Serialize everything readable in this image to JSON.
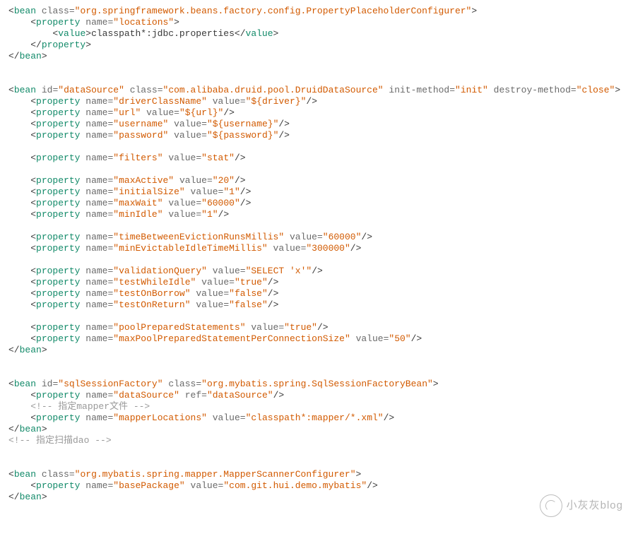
{
  "indent": "    ",
  "beans": [
    {
      "tag": "bean",
      "attrs": [
        [
          "class",
          "org.springframework.beans.factory.config.PropertyPlaceholderConfigurer"
        ]
      ],
      "children": [
        {
          "tag": "property",
          "attrs": [
            [
              "name",
              "locations"
            ]
          ],
          "children": [
            {
              "tag": "value",
              "text": "classpath*:jdbc.properties"
            }
          ]
        }
      ]
    },
    {
      "tag": "bean",
      "attrs": [
        [
          "id",
          "dataSource"
        ],
        [
          "class",
          "com.alibaba.druid.pool.DruidDataSource"
        ],
        [
          "init-method",
          "init"
        ],
        [
          "destroy-method",
          "close"
        ]
      ],
      "children": [
        {
          "tag": "property",
          "attrs": [
            [
              "name",
              "driverClassName"
            ],
            [
              "value",
              "${driver}"
            ]
          ],
          "selfclose": true
        },
        {
          "tag": "property",
          "attrs": [
            [
              "name",
              "url"
            ],
            [
              "value",
              "${url}"
            ]
          ],
          "selfclose": true
        },
        {
          "tag": "property",
          "attrs": [
            [
              "name",
              "username"
            ],
            [
              "value",
              "${username}"
            ]
          ],
          "selfclose": true
        },
        {
          "tag": "property",
          "attrs": [
            [
              "name",
              "password"
            ],
            [
              "value",
              "${password}"
            ]
          ],
          "selfclose": true
        },
        {
          "blank": true
        },
        {
          "tag": "property",
          "attrs": [
            [
              "name",
              "filters"
            ],
            [
              "value",
              "stat"
            ]
          ],
          "selfclose": true
        },
        {
          "blank": true
        },
        {
          "tag": "property",
          "attrs": [
            [
              "name",
              "maxActive"
            ],
            [
              "value",
              "20"
            ]
          ],
          "selfclose": true
        },
        {
          "tag": "property",
          "attrs": [
            [
              "name",
              "initialSize"
            ],
            [
              "value",
              "1"
            ]
          ],
          "selfclose": true
        },
        {
          "tag": "property",
          "attrs": [
            [
              "name",
              "maxWait"
            ],
            [
              "value",
              "60000"
            ]
          ],
          "selfclose": true
        },
        {
          "tag": "property",
          "attrs": [
            [
              "name",
              "minIdle"
            ],
            [
              "value",
              "1"
            ]
          ],
          "selfclose": true
        },
        {
          "blank": true
        },
        {
          "tag": "property",
          "attrs": [
            [
              "name",
              "timeBetweenEvictionRunsMillis"
            ],
            [
              "value",
              "60000"
            ]
          ],
          "selfclose": true
        },
        {
          "tag": "property",
          "attrs": [
            [
              "name",
              "minEvictableIdleTimeMillis"
            ],
            [
              "value",
              "300000"
            ]
          ],
          "selfclose": true
        },
        {
          "blank": true
        },
        {
          "tag": "property",
          "attrs": [
            [
              "name",
              "validationQuery"
            ],
            [
              "value",
              "SELECT 'x'"
            ]
          ],
          "selfclose": true
        },
        {
          "tag": "property",
          "attrs": [
            [
              "name",
              "testWhileIdle"
            ],
            [
              "value",
              "true"
            ]
          ],
          "selfclose": true
        },
        {
          "tag": "property",
          "attrs": [
            [
              "name",
              "testOnBorrow"
            ],
            [
              "value",
              "false"
            ]
          ],
          "selfclose": true
        },
        {
          "tag": "property",
          "attrs": [
            [
              "name",
              "testOnReturn"
            ],
            [
              "value",
              "false"
            ]
          ],
          "selfclose": true
        },
        {
          "blank": true
        },
        {
          "tag": "property",
          "attrs": [
            [
              "name",
              "poolPreparedStatements"
            ],
            [
              "value",
              "true"
            ]
          ],
          "selfclose": true
        },
        {
          "tag": "property",
          "attrs": [
            [
              "name",
              "maxPoolPreparedStatementPerConnectionSize"
            ],
            [
              "value",
              "50"
            ]
          ],
          "selfclose": true
        }
      ]
    },
    {
      "tag": "bean",
      "attrs": [
        [
          "id",
          "sqlSessionFactory"
        ],
        [
          "class",
          "org.mybatis.spring.SqlSessionFactoryBean"
        ]
      ],
      "children": [
        {
          "tag": "property",
          "attrs": [
            [
              "name",
              "dataSource"
            ],
            [
              "ref",
              "dataSource"
            ]
          ],
          "selfclose": true
        },
        {
          "comment": "指定mapper文件"
        },
        {
          "tag": "property",
          "attrs": [
            [
              "name",
              "mapperLocations"
            ],
            [
              "value",
              "classpath*:mapper/*.xml"
            ]
          ],
          "selfclose": true
        }
      ]
    },
    {
      "comment": "指定扫描dao",
      "toplevel": true
    },
    {
      "tag": "bean",
      "attrs": [
        [
          "class",
          "org.mybatis.spring.mapper.MapperScannerConfigurer"
        ]
      ],
      "children": [
        {
          "tag": "property",
          "attrs": [
            [
              "name",
              "basePackage"
            ],
            [
              "value",
              "com.git.hui.demo.mybatis"
            ]
          ],
          "selfclose": true
        }
      ]
    }
  ],
  "watermark": "小灰灰blog"
}
